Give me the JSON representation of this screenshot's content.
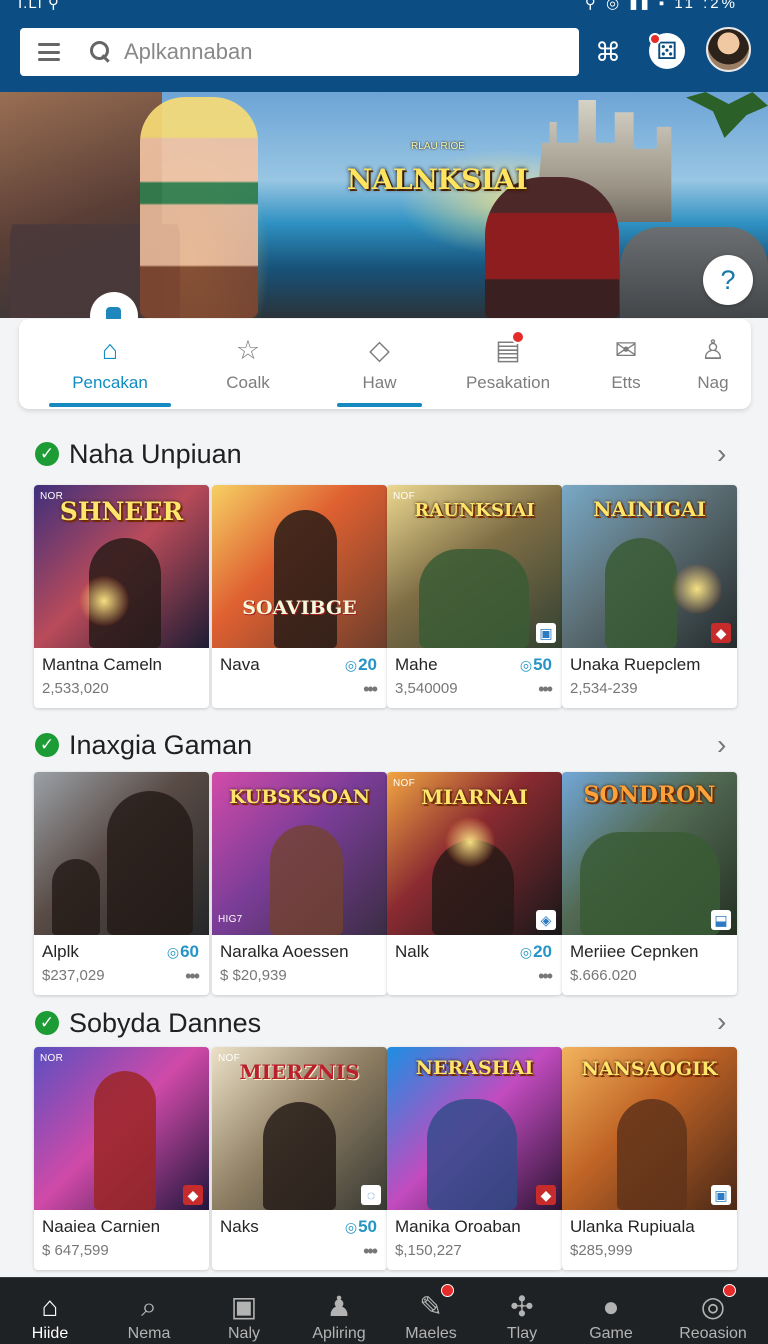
{
  "status_bar": {
    "left": "I.LI ⚲",
    "right": "⚲ ◎ ▮▮ ▪ 11 :2%"
  },
  "header": {
    "search_placeholder": "Aplkannaban"
  },
  "hero": {
    "title": "NALNKSIAI",
    "subtitle": "RLAU RIOE"
  },
  "tabs": [
    {
      "label": "Pencakan",
      "icon": "home-icon",
      "active": true
    },
    {
      "label": "Coalk",
      "icon": "star-outline-icon",
      "active": false
    },
    {
      "label": "Haw",
      "icon": "diamond-icon",
      "active": false,
      "underlined": true
    },
    {
      "label": "Pesakation",
      "icon": "list-notification-icon",
      "active": false,
      "badge": true
    },
    {
      "label": "Etts",
      "icon": "inbox-icon",
      "active": false
    },
    {
      "label": "Nag",
      "icon": "user-icon",
      "active": false
    }
  ],
  "sections": [
    {
      "title": "Naha Unpiuan",
      "cards": [
        {
          "art_title": "SHNEER",
          "tag": "NOR",
          "name": "Mantna Cameln",
          "meta": "2,533,020",
          "price": ""
        },
        {
          "art_title": "SOAVIBGE",
          "tag": "",
          "name": "Nava",
          "meta": "",
          "price": "20"
        },
        {
          "art_title": "RAUNKSIAI",
          "tag": "NOF",
          "name": "Mahe",
          "meta": "3,540009",
          "price": "50"
        },
        {
          "art_title": "NAINIGAI",
          "tag": "",
          "name": "Unaka Ruepclem",
          "meta": "2,534-239",
          "price": ""
        }
      ]
    },
    {
      "title": "Inaxgia Gaman",
      "cards": [
        {
          "art_title": "",
          "tag": "",
          "name": "Alplk",
          "meta": "$237,029",
          "price": "60"
        },
        {
          "art_title": "KUBSKSOAN",
          "tag": "HIG7",
          "name": "Naralka Aoessen",
          "meta": "$ $20,939",
          "price": ""
        },
        {
          "art_title": "MIARNAI",
          "tag": "NOF",
          "name": "Nalk",
          "meta": "",
          "price": "20"
        },
        {
          "art_title": "SONDRON",
          "tag": "",
          "name": "Meriiee Cepnken",
          "meta": "$.666.020",
          "price": ""
        }
      ]
    },
    {
      "title": "Sobyda Dannes",
      "cards": [
        {
          "art_title": "",
          "tag": "NOR",
          "name": "Naaiea Carnien",
          "meta": "$ 647,599",
          "price": ""
        },
        {
          "art_title": "MIERZNIS",
          "tag": "NOF",
          "name": "Naks",
          "meta": "",
          "price": "50"
        },
        {
          "art_title": "NERASHAI",
          "tag": "",
          "name": "Manika Oroaban",
          "meta": "$,150,227",
          "price": ""
        },
        {
          "art_title": "NANSAOGIK",
          "tag": "",
          "name": "Ulanka Rupiuala",
          "meta": "$285,999",
          "price": ""
        }
      ]
    }
  ],
  "bottom_nav": [
    {
      "label": "Hiide",
      "icon": "home-icon",
      "active": true
    },
    {
      "label": "Nema",
      "icon": "search-icon",
      "active": false
    },
    {
      "label": "Naly",
      "icon": "media-icon",
      "active": false
    },
    {
      "label": "Apliring",
      "icon": "character-icon",
      "active": false
    },
    {
      "label": "Maeles",
      "icon": "edit-icon",
      "active": false,
      "badge": true
    },
    {
      "label": "Tlay",
      "icon": "puzzle-icon",
      "active": false
    },
    {
      "label": "Game",
      "icon": "ball-icon",
      "active": false
    },
    {
      "label": "Reoasion",
      "icon": "camera-icon",
      "active": false,
      "badge": true
    }
  ],
  "colors": {
    "header": "#0c4e84",
    "accent": "#118cc1",
    "success": "#1d9c36",
    "nav_background": "#1f2224"
  }
}
